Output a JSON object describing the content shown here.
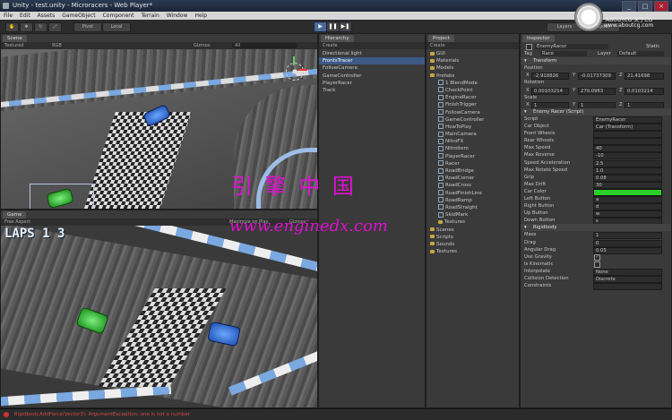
{
  "window": {
    "title": "Unity - test.unity - Microracers - Web Player*"
  },
  "menu": [
    "File",
    "Edit",
    "Assets",
    "GameObject",
    "Component",
    "Terrain",
    "Window",
    "Help"
  ],
  "toolbar": {
    "local": "Local",
    "layers": "Layers",
    "layout": "Layout"
  },
  "scene": {
    "tab": "Scene",
    "mode": "Textured",
    "rgb": "RGB",
    "gizmos": "Gizmos",
    "search": "All"
  },
  "game": {
    "tab": "Game",
    "aspect": "Free Aspect",
    "maximize": "Maximize on Play",
    "gizmos": "Gizmos",
    "laps": "LAPS 1 3"
  },
  "hierarchy": {
    "tab": "Hierarchy",
    "create": "Create",
    "items": [
      "Directional light",
      "FrontsTracer",
      "FollowCamera",
      "GameController",
      "PlayerRacer",
      "Track"
    ],
    "selected": 1
  },
  "project": {
    "tab": "Project",
    "create": "Create",
    "items": [
      {
        "label": "GUI",
        "indent": 0,
        "type": "folder"
      },
      {
        "label": "Materials",
        "indent": 0,
        "type": "folder"
      },
      {
        "label": "Models",
        "indent": 0,
        "type": "folder"
      },
      {
        "label": "Prefabs",
        "indent": 0,
        "type": "folder"
      },
      {
        "label": "1 BlendMode",
        "indent": 1,
        "type": "prefab"
      },
      {
        "label": "CheckPoint",
        "indent": 1,
        "type": "prefab"
      },
      {
        "label": "EngineRacer",
        "indent": 1,
        "type": "prefab"
      },
      {
        "label": "FinishTrigger",
        "indent": 1,
        "type": "prefab"
      },
      {
        "label": "FollowCamera",
        "indent": 1,
        "type": "prefab"
      },
      {
        "label": "GameController",
        "indent": 1,
        "type": "prefab"
      },
      {
        "label": "HowToPlay",
        "indent": 1,
        "type": "prefab"
      },
      {
        "label": "MainCamera",
        "indent": 1,
        "type": "prefab"
      },
      {
        "label": "NitroFX",
        "indent": 1,
        "type": "prefab"
      },
      {
        "label": "NitroItem",
        "indent": 1,
        "type": "prefab"
      },
      {
        "label": "PlayerRacer",
        "indent": 1,
        "type": "prefab"
      },
      {
        "label": "Racer",
        "indent": 1,
        "type": "prefab"
      },
      {
        "label": "RoadBridge",
        "indent": 1,
        "type": "prefab"
      },
      {
        "label": "RoadCorner",
        "indent": 1,
        "type": "prefab"
      },
      {
        "label": "RoadCross",
        "indent": 1,
        "type": "prefab"
      },
      {
        "label": "RoadFinishLine",
        "indent": 1,
        "type": "prefab"
      },
      {
        "label": "RoadRamp",
        "indent": 1,
        "type": "prefab"
      },
      {
        "label": "RoadStraight",
        "indent": 1,
        "type": "prefab"
      },
      {
        "label": "SkidMark",
        "indent": 1,
        "type": "prefab"
      },
      {
        "label": "Textures",
        "indent": 1,
        "type": "folder"
      },
      {
        "label": "Scenes",
        "indent": 0,
        "type": "folder"
      },
      {
        "label": "Scripts",
        "indent": 0,
        "type": "folder"
      },
      {
        "label": "Sounds",
        "indent": 0,
        "type": "folder"
      },
      {
        "label": "Textures",
        "indent": 0,
        "type": "folder"
      }
    ]
  },
  "inspector": {
    "tab": "Inspector",
    "object_name": "EnemyRacer",
    "static": "Static",
    "tag_label": "Tag",
    "tag": "Race",
    "layer_label": "Layer",
    "layer": "Default",
    "transform": {
      "title": "Transform",
      "position": "Position",
      "rotation": "Rotation",
      "scale": "Scale",
      "pos": [
        "-2.918826",
        "-0.01737309",
        "21.41698"
      ],
      "rot": [
        "0.00103214",
        "270.0963",
        "0.0103214"
      ],
      "scl": [
        "1",
        "1",
        "1"
      ]
    },
    "script": {
      "title": "Enemy Racer (Script)",
      "fields": [
        {
          "k": "Script",
          "v": "EnemyRacer"
        },
        {
          "k": "Car Object",
          "v": "Car (Transform)"
        },
        {
          "k": "Front Wheels",
          "v": ""
        },
        {
          "k": "Rear Wheels",
          "v": ""
        },
        {
          "k": "Max Speed",
          "v": "40"
        },
        {
          "k": "Max Reverse",
          "v": "-10"
        },
        {
          "k": "Speed Acceleration",
          "v": "2.5"
        },
        {
          "k": "Max Rotate Speed",
          "v": "1.0"
        },
        {
          "k": "Grip",
          "v": "0.08"
        },
        {
          "k": "Max Drift",
          "v": "30"
        },
        {
          "k": "Car Color",
          "v": ""
        },
        {
          "k": "Left Button",
          "v": "a"
        },
        {
          "k": "Right Button",
          "v": "d"
        },
        {
          "k": "Up Button",
          "v": "w"
        },
        {
          "k": "Down Button",
          "v": "s"
        }
      ]
    },
    "rigidbody": {
      "title": "Rigidbody",
      "fields": [
        {
          "k": "Mass",
          "v": "1"
        },
        {
          "k": "Drag",
          "v": "0"
        },
        {
          "k": "Angular Drag",
          "v": "0.05"
        },
        {
          "k": "Use Gravity",
          "v": "✓"
        },
        {
          "k": "Is Kinematic",
          "v": ""
        },
        {
          "k": "Interpolate",
          "v": "None"
        },
        {
          "k": "Collision Detection",
          "v": "Discrete"
        },
        {
          "k": "Constraints",
          "v": ""
        }
      ]
    },
    "car_color": "#2ad02a"
  },
  "watermark": {
    "cn": "引 擎 中 国",
    "url": "www.enginedx.com",
    "site": "www.aboutcg.com",
    "site_name": "ABOUTCG 关于CG"
  },
  "status": {
    "text": "Rigidbody.AddForce(Vector3): ArgumentException: one is not a number"
  }
}
